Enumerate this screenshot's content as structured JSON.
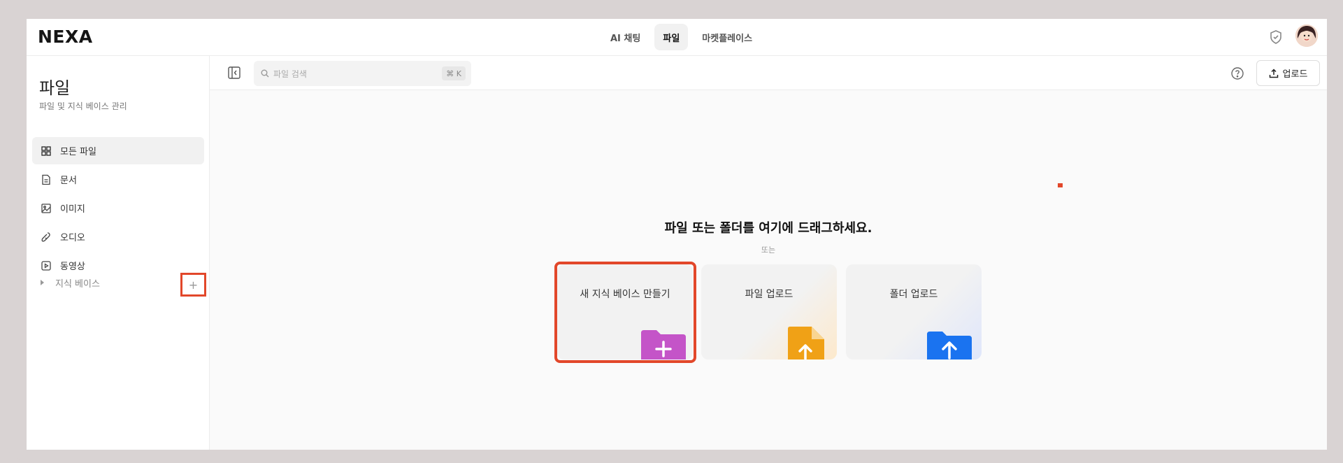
{
  "app": {
    "logo": "NEXA"
  },
  "topnav": {
    "tabs": [
      {
        "label": "AI 채팅",
        "active": false
      },
      {
        "label": "파일",
        "active": true
      },
      {
        "label": "마켓플레이스",
        "active": false
      }
    ]
  },
  "sidebar": {
    "title": "파일",
    "subtitle": "파일 및 지식 베이스 관리",
    "items": [
      {
        "label": "모든 파일",
        "icon": "grid-icon",
        "active": true
      },
      {
        "label": "문서",
        "icon": "document-icon",
        "active": false
      },
      {
        "label": "이미지",
        "icon": "image-icon",
        "active": false
      },
      {
        "label": "오디오",
        "icon": "audio-icon",
        "active": false
      },
      {
        "label": "동영상",
        "icon": "video-icon",
        "active": false
      }
    ],
    "knowledge_base": {
      "label": "지식 베이스",
      "add": "+"
    }
  },
  "toolbar": {
    "search_placeholder": "파일 검색",
    "shortcut": "⌘ K",
    "upload_label": "업로드"
  },
  "dropzone": {
    "title": "파일 또는 폴더를 여기에 드래그하세요.",
    "or": "또는",
    "cards": [
      {
        "label": "새 지식 베이스 만들기",
        "color": "#c454c8"
      },
      {
        "label": "파일 업로드",
        "color": "#f0a116"
      },
      {
        "label": "폴더 업로드",
        "color": "#1a73f0"
      }
    ]
  },
  "colors": {
    "highlight": "#e2472a"
  }
}
